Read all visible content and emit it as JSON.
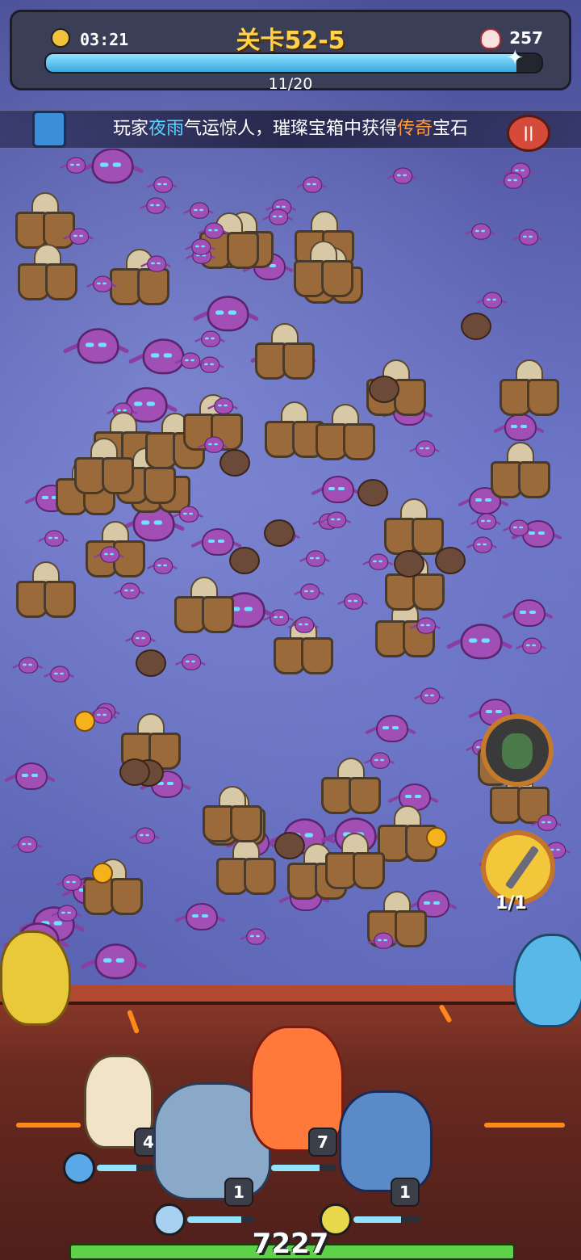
{
  "hud": {
    "timer": "03:21",
    "stage": "关卡52-5",
    "kills": "257",
    "wave": "11/20",
    "wave_progress": 0.95,
    "icons": {
      "timer": "clock-icon",
      "kills": "skull-icon"
    }
  },
  "notice": {
    "prefix": "玩家",
    "player": "夜雨",
    "middle": "气运惊人，璀璨宝箱中获得",
    "rarity": "传奇",
    "suffix": "宝石"
  },
  "skills": {
    "sword_count": "1/1"
  },
  "heroes": [
    {
      "name": "ice-princess",
      "level": "4",
      "element": "diamond",
      "hp": 0.7
    },
    {
      "name": "ice-knight",
      "level": "1",
      "element": "crystal",
      "hp": 0.8
    },
    {
      "name": "fire-sorceress",
      "level": "7",
      "element": "fire",
      "hp": 0.75
    },
    {
      "name": "blue-troll",
      "level": "1",
      "element": "lightning",
      "hp": 0.7
    }
  ],
  "power": "7227",
  "colors": {
    "accent": "#ffd24a",
    "player_name": "#5bd4ff",
    "legendary": "#ff9d3a",
    "progress": "#3ba8e0"
  }
}
